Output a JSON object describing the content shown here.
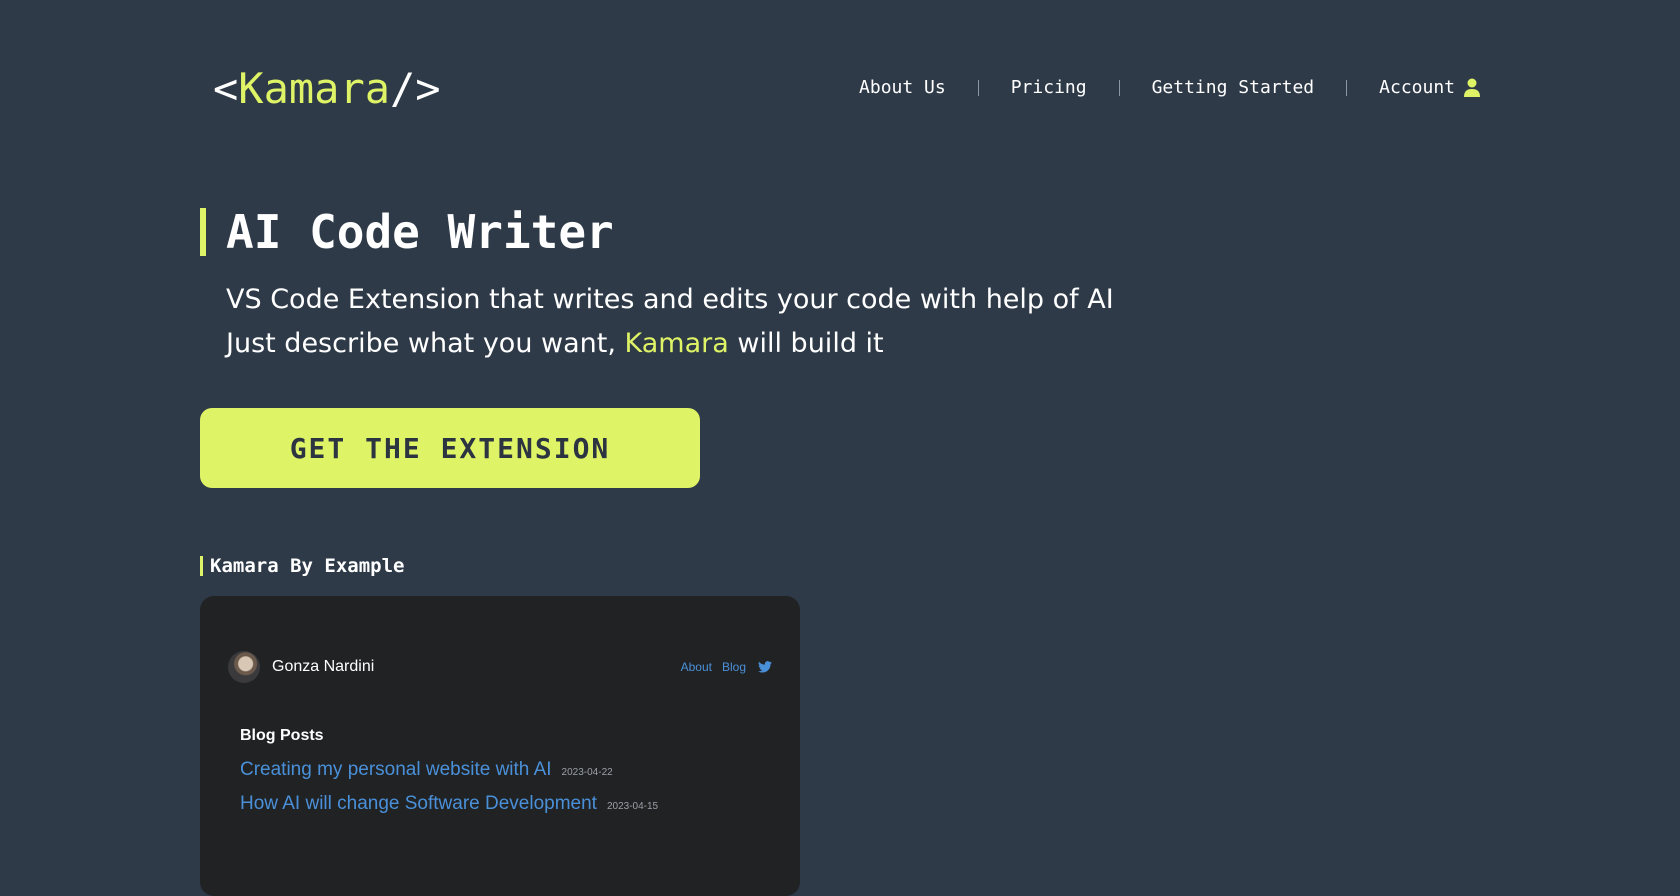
{
  "header": {
    "logo": {
      "open": "<",
      "brand": "Kamara",
      "close": "/>"
    },
    "nav": [
      {
        "label": "About Us"
      },
      {
        "label": "Pricing"
      },
      {
        "label": "Getting Started"
      },
      {
        "label": "Account",
        "icon": "user-icon"
      }
    ]
  },
  "hero": {
    "title": "AI Code Writer",
    "line1": "VS Code Extension that writes and edits your code with help of AI",
    "line2_before": "Just describe what you want,",
    "line2_highlight": "Kamara",
    "line2_after": "will build it",
    "cta_label": "GET THE EXTENSION"
  },
  "section": {
    "title": "Kamara By Example"
  },
  "example_card": {
    "author": "Gonza Nardini",
    "nav": [
      {
        "label": "About"
      },
      {
        "label": "Blog"
      },
      {
        "icon": "twitter-icon"
      }
    ],
    "posts_title": "Blog Posts",
    "posts": [
      {
        "title": "Creating my personal website with AI",
        "date": "2023-04-22"
      },
      {
        "title": "How AI will change Software Development",
        "date": "2023-04-15"
      }
    ]
  },
  "colors": {
    "background": "#2e3a48",
    "accent": "#dff366",
    "card_background": "#212224",
    "link": "#4a90d9"
  }
}
